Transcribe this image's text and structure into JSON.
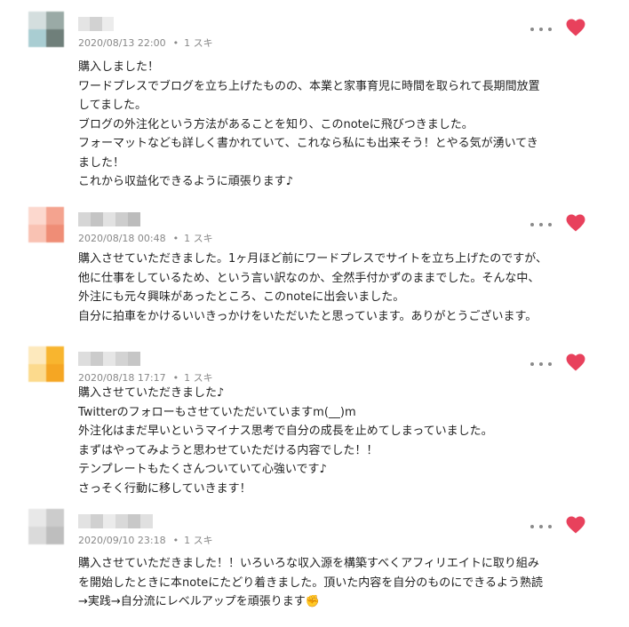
{
  "comments": [
    {
      "date": "2020/08/13 22:00",
      "likes": "1 スキ",
      "lines": [
        "購入しました！",
        "ワードプレスでブログを立ち上げたものの、本業と家事育児に時間を取られて長期間放置",
        "してました。",
        "ブログの外注化という方法があることを知り、このnoteに飛びつきました。",
        "フォーマットなども詳しく書かれていて、これなら私にも出来そう！とやる気が湧いてき",
        "ました！",
        "これから収益化できるように頑張ります♪"
      ]
    },
    {
      "date": "2020/08/18 00:48",
      "likes": "1 スキ",
      "lines": [
        "購入させていただきました。1ヶ月ほど前にワードプレスでサイトを立ち上げたのですが、",
        "他に仕事をしているため、という言い訳なのか、全然手付かずのままでした。そんな中、",
        "外注にも元々興味があったところ、このnoteに出会いました。",
        "自分に拍車をかけるいいきっかけをいただいたと思っています。ありがとうございます。"
      ]
    },
    {
      "date": "2020/08/18 17:17",
      "likes": "1 スキ",
      "lines": [
        "購入させていただきました♪",
        "Twitterのフォローもさせていただいていますm(__)m",
        "外注化はまだ早いというマイナス思考で自分の成長を止めてしまっていました。",
        "まずはやってみようと思わせていただける内容でした！！",
        "テンプレートもたくさんついていて心強いです♪",
        "さっそく行動に移していきます！"
      ]
    },
    {
      "date": "2020/09/10 23:18",
      "likes": "1 スキ",
      "lines": [
        "購入させていただきました！！いろいろな収入源を構築すべくアフィリエイトに取り組み",
        "を開始したときに本noteにたどり着きました。頂いた内容を自分のものにできるよう熟読",
        "→実践→自分流にレベルアップを頑張ります✊"
      ]
    }
  ],
  "colors": {
    "heart": "#e8415c",
    "meta_text": "#888888",
    "body_text": "#222222",
    "avatar_1": [
      "#c9d5d5",
      "#8fa3a0",
      "#a7c9cf",
      "#6e7f7b"
    ],
    "avatar_2": [
      "#fbd9cf",
      "#f5a896",
      "#f9c3b4",
      "#f08e78"
    ],
    "avatar_3": [
      "#fde6b6",
      "#f7b733",
      "#fcd98a",
      "#f5a623"
    ],
    "avatar_4": [
      "#e6e6e6",
      "#c9c9c9",
      "#d8d8d8",
      "#bdbdbd"
    ]
  },
  "icons": {
    "more": "more-horizontal-icon",
    "like": "heart-icon"
  }
}
